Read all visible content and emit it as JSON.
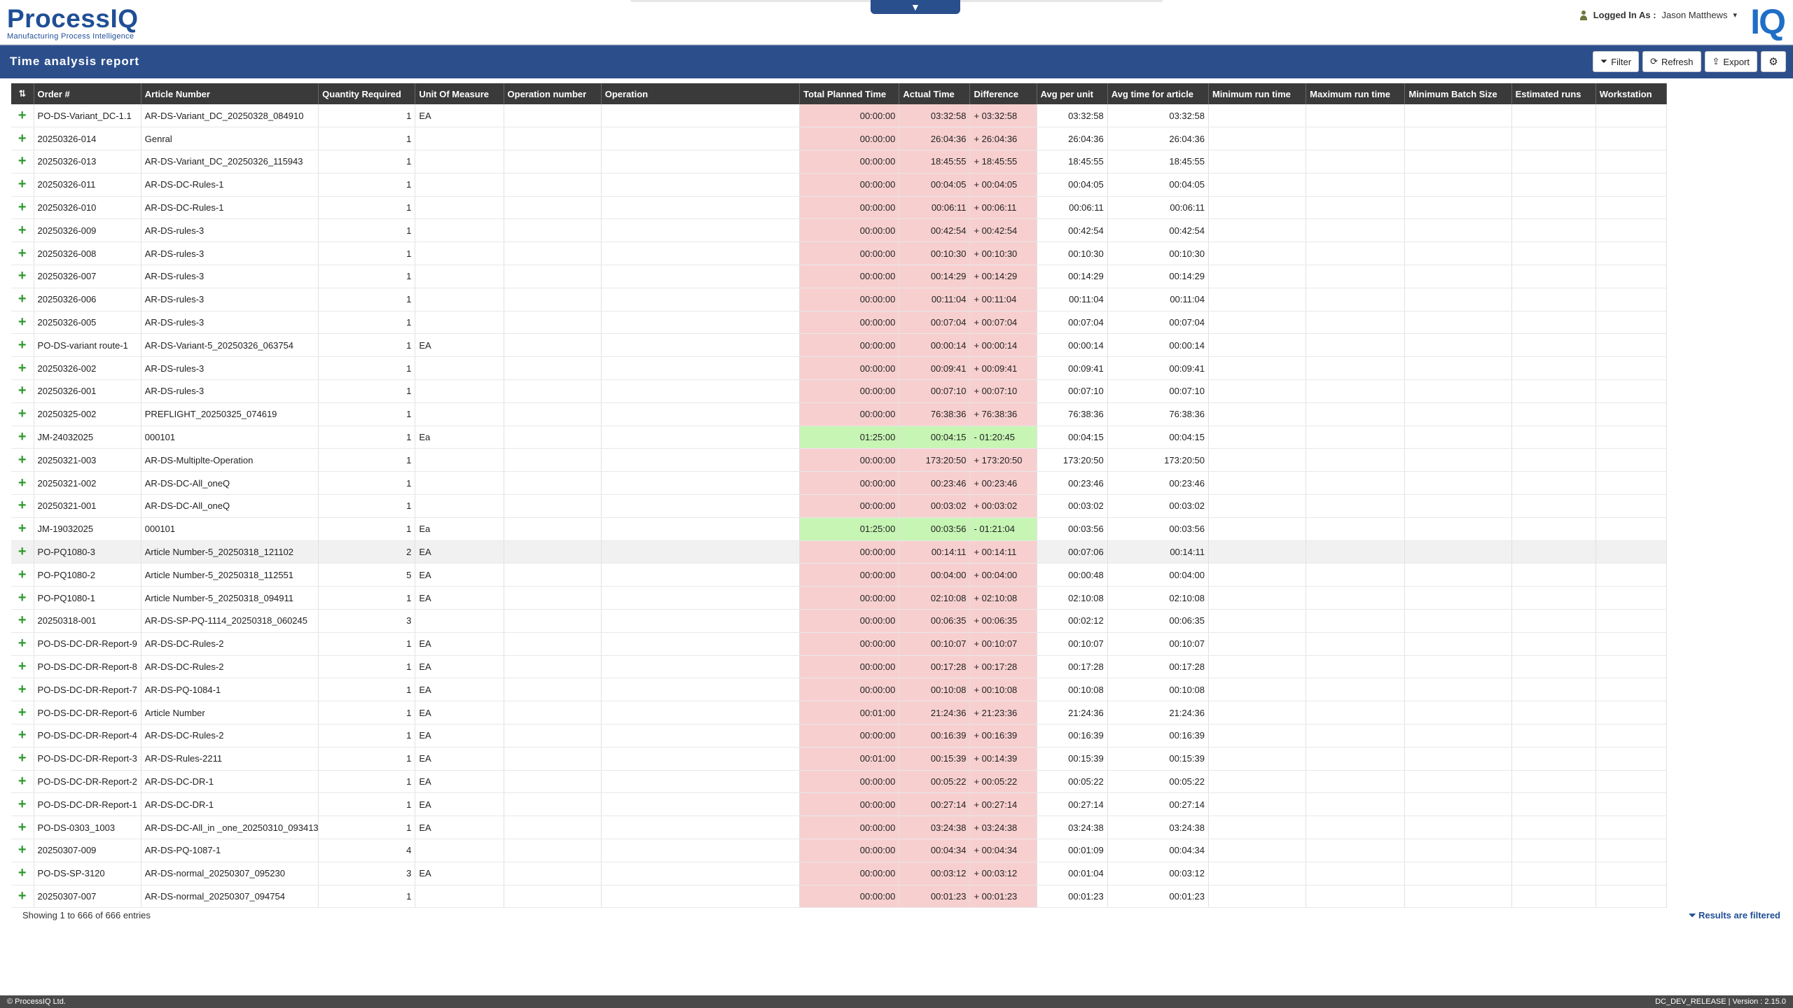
{
  "header": {
    "brand": "ProcessIQ",
    "tagline": "Manufacturing Process Intelligence",
    "login_label": "Logged In As :",
    "user": "Jason Matthews",
    "mark": "IQ"
  },
  "toolbar": {
    "title": "Time analysis report",
    "filter_label": "Filter",
    "refresh_label": "Refresh",
    "export_label": "Export"
  },
  "table": {
    "columns": [
      "Order #",
      "Article Number",
      "Quantity Required",
      "Unit Of Measure",
      "Operation number",
      "Operation",
      "Total Planned Time",
      "Actual Time",
      "Difference",
      "Avg per unit",
      "Avg time for article",
      "Minimum run time",
      "Maximum run time",
      "Minimum Batch Size",
      "Estimated runs",
      "Workstation"
    ],
    "rows": [
      {
        "order": "PO-DS-Variant_DC-1.1",
        "article": "AR-DS-Variant_DC_20250328_084910",
        "qty": "1",
        "uom": "EA",
        "planned": "00:00:00",
        "actual": "03:32:58",
        "diff": "+ 03:32:58",
        "avg": "03:32:58",
        "avgart": "03:32:58",
        "status": "red"
      },
      {
        "order": "20250326-014",
        "article": "Genral",
        "qty": "1",
        "uom": "",
        "planned": "00:00:00",
        "actual": "26:04:36",
        "diff": "+ 26:04:36",
        "avg": "26:04:36",
        "avgart": "26:04:36",
        "status": "red"
      },
      {
        "order": "20250326-013",
        "article": "AR-DS-Variant_DC_20250326_115943",
        "qty": "1",
        "uom": "",
        "planned": "00:00:00",
        "actual": "18:45:55",
        "diff": "+ 18:45:55",
        "avg": "18:45:55",
        "avgart": "18:45:55",
        "status": "red"
      },
      {
        "order": "20250326-011",
        "article": "AR-DS-DC-Rules-1",
        "qty": "1",
        "uom": "",
        "planned": "00:00:00",
        "actual": "00:04:05",
        "diff": "+ 00:04:05",
        "avg": "00:04:05",
        "avgart": "00:04:05",
        "status": "red"
      },
      {
        "order": "20250326-010",
        "article": "AR-DS-DC-Rules-1",
        "qty": "1",
        "uom": "",
        "planned": "00:00:00",
        "actual": "00:06:11",
        "diff": "+ 00:06:11",
        "avg": "00:06:11",
        "avgart": "00:06:11",
        "status": "red"
      },
      {
        "order": "20250326-009",
        "article": "AR-DS-rules-3",
        "qty": "1",
        "uom": "",
        "planned": "00:00:00",
        "actual": "00:42:54",
        "diff": "+ 00:42:54",
        "avg": "00:42:54",
        "avgart": "00:42:54",
        "status": "red"
      },
      {
        "order": "20250326-008",
        "article": "AR-DS-rules-3",
        "qty": "1",
        "uom": "",
        "planned": "00:00:00",
        "actual": "00:10:30",
        "diff": "+ 00:10:30",
        "avg": "00:10:30",
        "avgart": "00:10:30",
        "status": "red"
      },
      {
        "order": "20250326-007",
        "article": "AR-DS-rules-3",
        "qty": "1",
        "uom": "",
        "planned": "00:00:00",
        "actual": "00:14:29",
        "diff": "+ 00:14:29",
        "avg": "00:14:29",
        "avgart": "00:14:29",
        "status": "red"
      },
      {
        "order": "20250326-006",
        "article": "AR-DS-rules-3",
        "qty": "1",
        "uom": "",
        "planned": "00:00:00",
        "actual": "00:11:04",
        "diff": "+ 00:11:04",
        "avg": "00:11:04",
        "avgart": "00:11:04",
        "status": "red"
      },
      {
        "order": "20250326-005",
        "article": "AR-DS-rules-3",
        "qty": "1",
        "uom": "",
        "planned": "00:00:00",
        "actual": "00:07:04",
        "diff": "+ 00:07:04",
        "avg": "00:07:04",
        "avgart": "00:07:04",
        "status": "red"
      },
      {
        "order": "PO-DS-variant route-1",
        "article": "AR-DS-Variant-5_20250326_063754",
        "qty": "1",
        "uom": "EA",
        "planned": "00:00:00",
        "actual": "00:00:14",
        "diff": "+ 00:00:14",
        "avg": "00:00:14",
        "avgart": "00:00:14",
        "status": "red"
      },
      {
        "order": "20250326-002",
        "article": "AR-DS-rules-3",
        "qty": "1",
        "uom": "",
        "planned": "00:00:00",
        "actual": "00:09:41",
        "diff": "+ 00:09:41",
        "avg": "00:09:41",
        "avgart": "00:09:41",
        "status": "red"
      },
      {
        "order": "20250326-001",
        "article": "AR-DS-rules-3",
        "qty": "1",
        "uom": "",
        "planned": "00:00:00",
        "actual": "00:07:10",
        "diff": "+ 00:07:10",
        "avg": "00:07:10",
        "avgart": "00:07:10",
        "status": "red"
      },
      {
        "order": "20250325-002",
        "article": "PREFLIGHT_20250325_074619",
        "qty": "1",
        "uom": "",
        "planned": "00:00:00",
        "actual": "76:38:36",
        "diff": "+ 76:38:36",
        "avg": "76:38:36",
        "avgart": "76:38:36",
        "status": "red"
      },
      {
        "order": "JM-24032025",
        "article": "000101",
        "qty": "1",
        "uom": "Ea",
        "planned": "01:25:00",
        "actual": "00:04:15",
        "diff": "- 01:20:45",
        "avg": "00:04:15",
        "avgart": "00:04:15",
        "status": "green"
      },
      {
        "order": "20250321-003",
        "article": "AR-DS-Multiplte-Operation",
        "qty": "1",
        "uom": "",
        "planned": "00:00:00",
        "actual": "173:20:50",
        "diff": "+ 173:20:50",
        "avg": "173:20:50",
        "avgart": "173:20:50",
        "status": "red"
      },
      {
        "order": "20250321-002",
        "article": "AR-DS-DC-All_oneQ",
        "qty": "1",
        "uom": "",
        "planned": "00:00:00",
        "actual": "00:23:46",
        "diff": "+ 00:23:46",
        "avg": "00:23:46",
        "avgart": "00:23:46",
        "status": "red"
      },
      {
        "order": "20250321-001",
        "article": "AR-DS-DC-All_oneQ",
        "qty": "1",
        "uom": "",
        "planned": "00:00:00",
        "actual": "00:03:02",
        "diff": "+ 00:03:02",
        "avg": "00:03:02",
        "avgart": "00:03:02",
        "status": "red"
      },
      {
        "order": "JM-19032025",
        "article": "000101",
        "qty": "1",
        "uom": "Ea",
        "planned": "01:25:00",
        "actual": "00:03:56",
        "diff": "- 01:21:04",
        "avg": "00:03:56",
        "avgart": "00:03:56",
        "status": "green"
      },
      {
        "order": "PO-PQ1080-3",
        "article": "Article Number-5_20250318_121102",
        "qty": "2",
        "uom": "EA",
        "planned": "00:00:00",
        "actual": "00:14:11",
        "diff": "+ 00:14:11",
        "avg": "00:07:06",
        "avgart": "00:14:11",
        "status": "red",
        "hl": true
      },
      {
        "order": "PO-PQ1080-2",
        "article": "Article Number-5_20250318_112551",
        "qty": "5",
        "uom": "EA",
        "planned": "00:00:00",
        "actual": "00:04:00",
        "diff": "+ 00:04:00",
        "avg": "00:00:48",
        "avgart": "00:04:00",
        "status": "red"
      },
      {
        "order": "PO-PQ1080-1",
        "article": "Article Number-5_20250318_094911",
        "qty": "1",
        "uom": "EA",
        "planned": "00:00:00",
        "actual": "02:10:08",
        "diff": "+ 02:10:08",
        "avg": "02:10:08",
        "avgart": "02:10:08",
        "status": "red"
      },
      {
        "order": "20250318-001",
        "article": "AR-DS-SP-PQ-1114_20250318_060245",
        "qty": "3",
        "uom": "",
        "planned": "00:00:00",
        "actual": "00:06:35",
        "diff": "+ 00:06:35",
        "avg": "00:02:12",
        "avgart": "00:06:35",
        "status": "red"
      },
      {
        "order": "PO-DS-DC-DR-Report-9",
        "article": "AR-DS-DC-Rules-2",
        "qty": "1",
        "uom": "EA",
        "planned": "00:00:00",
        "actual": "00:10:07",
        "diff": "+ 00:10:07",
        "avg": "00:10:07",
        "avgart": "00:10:07",
        "status": "red"
      },
      {
        "order": "PO-DS-DC-DR-Report-8",
        "article": "AR-DS-DC-Rules-2",
        "qty": "1",
        "uom": "EA",
        "planned": "00:00:00",
        "actual": "00:17:28",
        "diff": "+ 00:17:28",
        "avg": "00:17:28",
        "avgart": "00:17:28",
        "status": "red"
      },
      {
        "order": "PO-DS-DC-DR-Report-7",
        "article": "AR-DS-PQ-1084-1",
        "qty": "1",
        "uom": "EA",
        "planned": "00:00:00",
        "actual": "00:10:08",
        "diff": "+ 00:10:08",
        "avg": "00:10:08",
        "avgart": "00:10:08",
        "status": "red"
      },
      {
        "order": "PO-DS-DC-DR-Report-6",
        "article": "Article Number",
        "qty": "1",
        "uom": "EA",
        "planned": "00:01:00",
        "actual": "21:24:36",
        "diff": "+ 21:23:36",
        "avg": "21:24:36",
        "avgart": "21:24:36",
        "status": "red"
      },
      {
        "order": "PO-DS-DC-DR-Report-4",
        "article": "AR-DS-DC-Rules-2",
        "qty": "1",
        "uom": "EA",
        "planned": "00:00:00",
        "actual": "00:16:39",
        "diff": "+ 00:16:39",
        "avg": "00:16:39",
        "avgart": "00:16:39",
        "status": "red"
      },
      {
        "order": "PO-DS-DC-DR-Report-3",
        "article": "AR-DS-Rules-2211",
        "qty": "1",
        "uom": "EA",
        "planned": "00:01:00",
        "actual": "00:15:39",
        "diff": "+ 00:14:39",
        "avg": "00:15:39",
        "avgart": "00:15:39",
        "status": "red"
      },
      {
        "order": "PO-DS-DC-DR-Report-2",
        "article": "AR-DS-DC-DR-1",
        "qty": "1",
        "uom": "EA",
        "planned": "00:00:00",
        "actual": "00:05:22",
        "diff": "+ 00:05:22",
        "avg": "00:05:22",
        "avgart": "00:05:22",
        "status": "red"
      },
      {
        "order": "PO-DS-DC-DR-Report-1",
        "article": "AR-DS-DC-DR-1",
        "qty": "1",
        "uom": "EA",
        "planned": "00:00:00",
        "actual": "00:27:14",
        "diff": "+ 00:27:14",
        "avg": "00:27:14",
        "avgart": "00:27:14",
        "status": "red"
      },
      {
        "order": "PO-DS-0303_1003",
        "article": "AR-DS-DC-All_in _one_20250310_093413",
        "qty": "1",
        "uom": "EA",
        "planned": "00:00:00",
        "actual": "03:24:38",
        "diff": "+ 03:24:38",
        "avg": "03:24:38",
        "avgart": "03:24:38",
        "status": "red"
      },
      {
        "order": "20250307-009",
        "article": "AR-DS-PQ-1087-1",
        "qty": "4",
        "uom": "",
        "planned": "00:00:00",
        "actual": "00:04:34",
        "diff": "+ 00:04:34",
        "avg": "00:01:09",
        "avgart": "00:04:34",
        "status": "red"
      },
      {
        "order": "PO-DS-SP-3120",
        "article": "AR-DS-normal_20250307_095230",
        "qty": "3",
        "uom": "EA",
        "planned": "00:00:00",
        "actual": "00:03:12",
        "diff": "+ 00:03:12",
        "avg": "00:01:04",
        "avgart": "00:03:12",
        "status": "red"
      },
      {
        "order": "20250307-007",
        "article": "AR-DS-normal_20250307_094754",
        "qty": "1",
        "uom": "",
        "planned": "00:00:00",
        "actual": "00:01:23",
        "diff": "+ 00:01:23",
        "avg": "00:01:23",
        "avgart": "00:01:23",
        "status": "red"
      }
    ]
  },
  "footer": {
    "entries": "Showing 1 to 666 of 666 entries",
    "filtered": "Results are filtered",
    "copyright": "© ProcessIQ Ltd.",
    "version": "DC_DEV_RELEASE | Version : 2.15.0"
  },
  "colors": {
    "primary": "#2c4f8c",
    "over": "#f7cfcf",
    "under": "#c6f5b4",
    "expand": "#2e9a2e"
  }
}
